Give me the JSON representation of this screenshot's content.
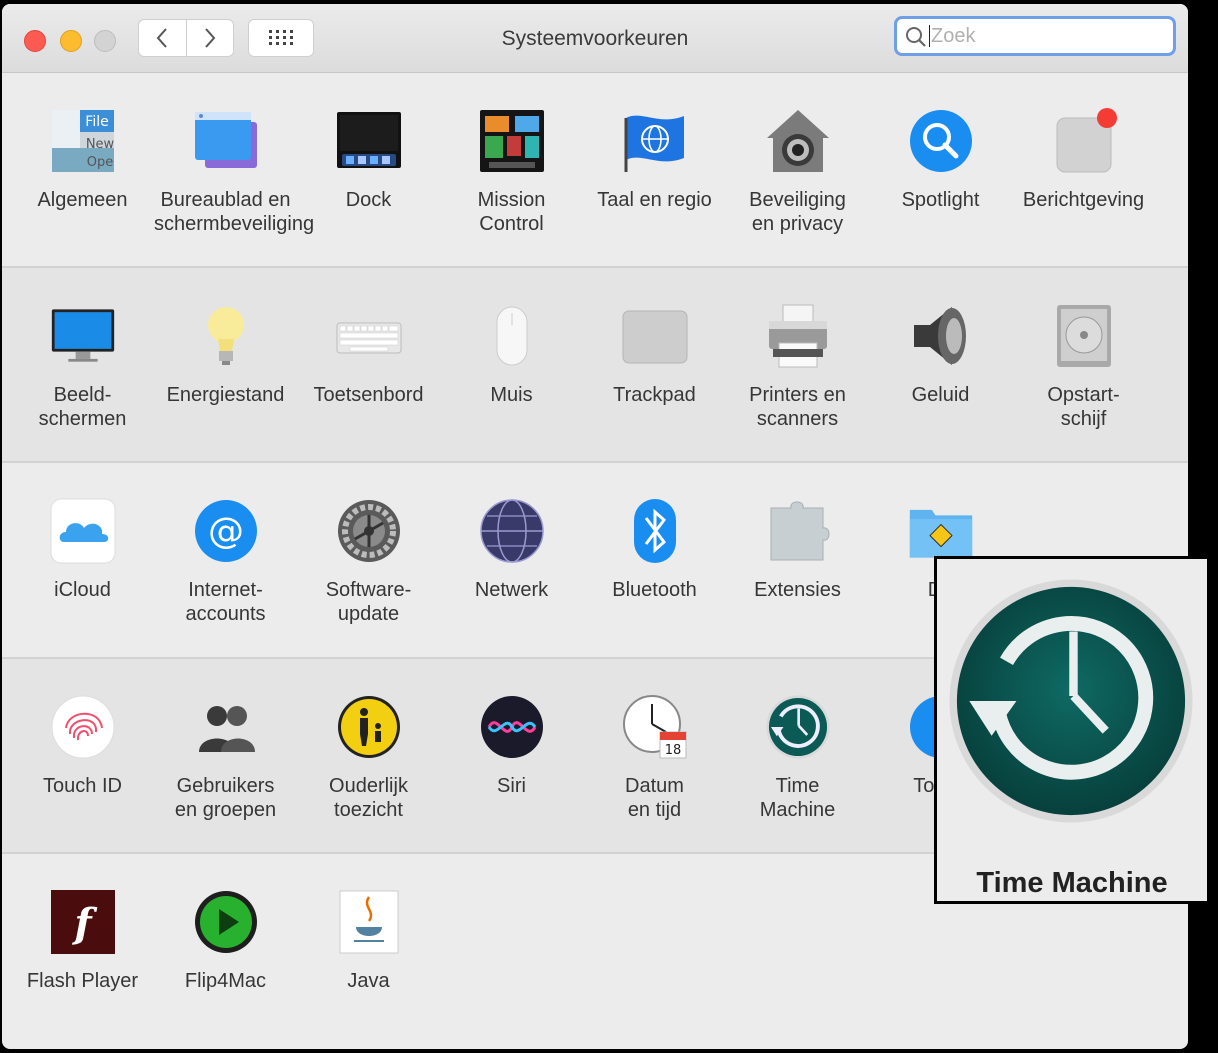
{
  "window": {
    "title": "Systeemvoorkeuren"
  },
  "toolbar": {
    "back_icon": "chevron-left-icon",
    "forward_icon": "chevron-right-icon",
    "grid_icon": "grid-icon",
    "search_placeholder": "Zoek"
  },
  "rows": [
    [
      {
        "id": "algemeen",
        "label": "Algemeen",
        "icon": "general-icon"
      },
      {
        "id": "bureaublad",
        "label": "Bureaublad en\nschermbeveiliging",
        "icon": "desktop-icon"
      },
      {
        "id": "dock",
        "label": "Dock",
        "icon": "dock-icon"
      },
      {
        "id": "mission-control",
        "label": "Mission\nControl",
        "icon": "mission-control-icon"
      },
      {
        "id": "taal",
        "label": "Taal en regio",
        "icon": "flag-globe-icon"
      },
      {
        "id": "beveiliging",
        "label": "Beveiliging\nen privacy",
        "icon": "security-house-icon"
      },
      {
        "id": "spotlight",
        "label": "Spotlight",
        "icon": "magnifier-icon"
      },
      {
        "id": "berichtgeving",
        "label": "Berichtgeving",
        "icon": "notification-icon"
      }
    ],
    [
      {
        "id": "beeldschermen",
        "label": "Beeld-\nschermen",
        "icon": "display-icon"
      },
      {
        "id": "energiestand",
        "label": "Energiestand",
        "icon": "lightbulb-icon"
      },
      {
        "id": "toetsenbord",
        "label": "Toetsenbord",
        "icon": "keyboard-icon"
      },
      {
        "id": "muis",
        "label": "Muis",
        "icon": "mouse-icon"
      },
      {
        "id": "trackpad",
        "label": "Trackpad",
        "icon": "trackpad-icon"
      },
      {
        "id": "printers",
        "label": "Printers en\nscanners",
        "icon": "printer-icon"
      },
      {
        "id": "geluid",
        "label": "Geluid",
        "icon": "speaker-icon"
      },
      {
        "id": "opstartschijf",
        "label": "Opstart-\nschijf",
        "icon": "hard-disk-icon"
      }
    ],
    [
      {
        "id": "icloud",
        "label": "iCloud",
        "icon": "cloud-icon"
      },
      {
        "id": "internetaccounts",
        "label": "Internet-\naccounts",
        "icon": "at-sign-icon"
      },
      {
        "id": "software-update",
        "label": "Software-update",
        "icon": "gear-icon"
      },
      {
        "id": "netwerk",
        "label": "Netwerk",
        "icon": "network-globe-icon"
      },
      {
        "id": "bluetooth",
        "label": "Bluetooth",
        "icon": "bluetooth-icon"
      },
      {
        "id": "extensies",
        "label": "Extensies",
        "icon": "puzzle-icon"
      },
      {
        "id": "delen",
        "label": "De",
        "icon": "sharing-folder-icon"
      }
    ],
    [
      {
        "id": "touch-id",
        "label": "Touch ID",
        "icon": "fingerprint-icon"
      },
      {
        "id": "gebruikers",
        "label": "Gebruikers\nen groepen",
        "icon": "users-icon"
      },
      {
        "id": "ouderlijk",
        "label": "Ouderlijk\ntoezicht",
        "icon": "parental-controls-icon"
      },
      {
        "id": "siri",
        "label": "Siri",
        "icon": "siri-icon"
      },
      {
        "id": "datum",
        "label": "Datum\nen tijd",
        "icon": "clock-calendar-icon"
      },
      {
        "id": "time-machine",
        "label": "Time\nMachine",
        "icon": "time-machine-icon"
      },
      {
        "id": "toegankelijkheid",
        "label": "Toega\nh",
        "icon": "accessibility-icon"
      }
    ],
    [
      {
        "id": "flash",
        "label": "Flash Player",
        "icon": "flash-icon"
      },
      {
        "id": "flip4mac",
        "label": "Flip4Mac",
        "icon": "play-circle-icon"
      },
      {
        "id": "java",
        "label": "Java",
        "icon": "java-cup-icon"
      }
    ]
  ],
  "callout": {
    "label": "Time Machine",
    "icon": "time-machine-icon"
  },
  "colors": {
    "accent": "#6f9fe8",
    "close": "#fd5b52",
    "minimize": "#fdbb2f",
    "time_machine": "#1f6b66"
  }
}
